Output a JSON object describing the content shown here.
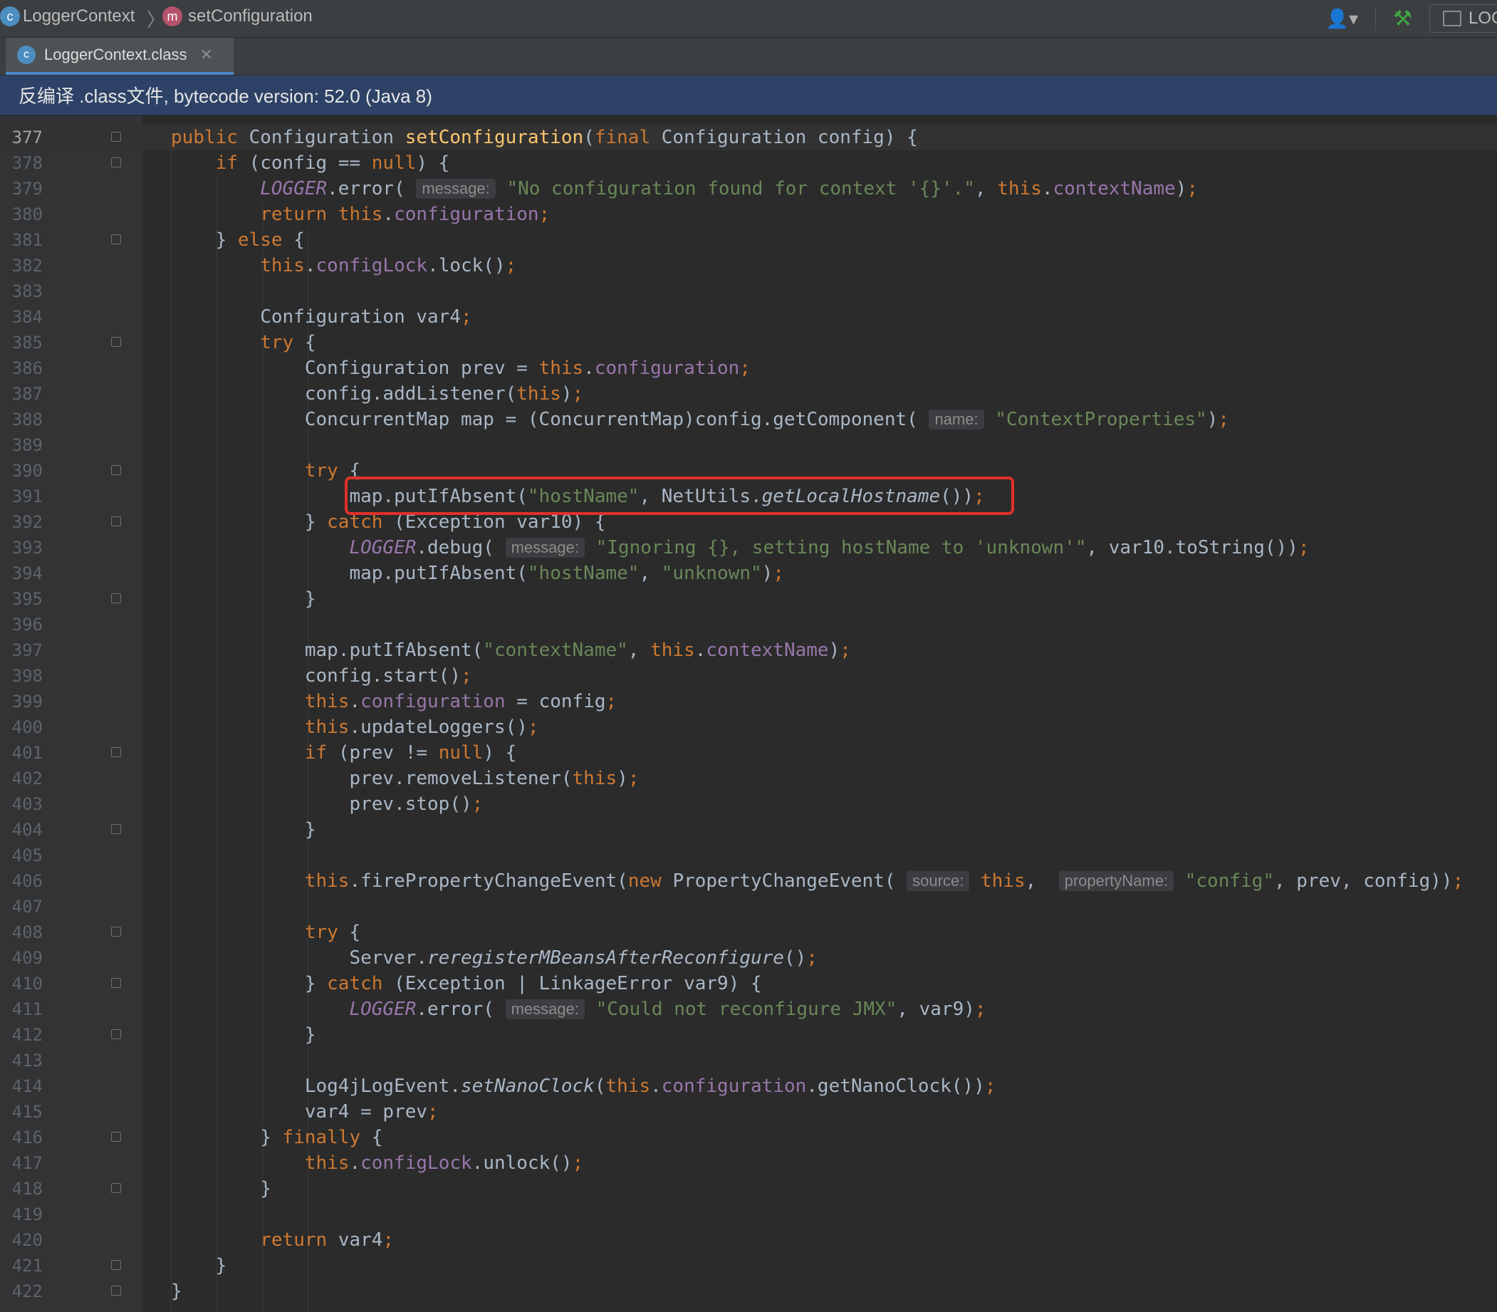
{
  "breadcrumb": {
    "class_icon": "class-icon",
    "class_icon_letter": "c",
    "class_name": "LoggerContext",
    "separator": "〉",
    "method_icon": "method-icon",
    "method_icon_letter": "m",
    "method_name": "setConfiguration"
  },
  "toolbar": {
    "user_icon": "user-dropdown-icon",
    "build_icon": "hammer-icon",
    "run_config_label": "LOG"
  },
  "tab": {
    "icon": "class-file-icon",
    "label": "LoggerContext.class",
    "close": "✕"
  },
  "banner": {
    "text": "反编译 .class文件, bytecode version: 52.0 (Java 8)"
  },
  "editor": {
    "current_line": 377,
    "highlighted_line": 391,
    "highlight_color": "#e0312a",
    "lines": [
      {
        "n": "377",
        "html": "<span class=\"kw\">public </span>Configuration <span class=\"fn\">setConfiguration</span>(<span class=\"kw\">final </span>Configuration config) {"
      },
      {
        "n": "378",
        "html": "    <span class=\"kw\">if </span>(config == <span class=\"kw\">null</span>) {"
      },
      {
        "n": "379",
        "html": "        <span class=\"st\">LOGGER</span>.error( <span class=\"hint\">message:</span> <span class=\"str\">\"No configuration found for context '{}'.\"</span>, <span class=\"kw\">this</span>.<span class=\"fld\">contextName</span>)<span class=\"kw\">;</span>"
      },
      {
        "n": "380",
        "html": "        <span class=\"kw\">return this</span>.<span class=\"fld\">configuration</span><span class=\"kw\">;</span>"
      },
      {
        "n": "381",
        "html": "    } <span class=\"kw\">else </span>{"
      },
      {
        "n": "382",
        "html": "        <span class=\"kw\">this</span>.<span class=\"fld\">configLock</span>.lock()<span class=\"kw\">;</span>"
      },
      {
        "n": "383",
        "html": ""
      },
      {
        "n": "384",
        "html": "        Configuration var4<span class=\"kw\">;</span>"
      },
      {
        "n": "385",
        "html": "        <span class=\"kw\">try </span>{"
      },
      {
        "n": "386",
        "html": "            Configuration prev = <span class=\"kw\">this</span>.<span class=\"fld\">configuration</span><span class=\"kw\">;</span>"
      },
      {
        "n": "387",
        "html": "            config.addListener(<span class=\"kw\">this</span>)<span class=\"kw\">;</span>"
      },
      {
        "n": "388",
        "html": "            ConcurrentMap map = (ConcurrentMap)config.getComponent( <span class=\"hint\">name:</span> <span class=\"str\">\"ContextProperties\"</span>)<span class=\"kw\">;</span>"
      },
      {
        "n": "389",
        "html": ""
      },
      {
        "n": "390",
        "html": "            <span class=\"kw\">try </span>{"
      },
      {
        "n": "391",
        "html": "                map.putIfAbsent(<span class=\"str\">\"hostName\"</span>, NetUtils.<span class=\"it\">getLocalHostname</span>())<span class=\"kw\">;</span>"
      },
      {
        "n": "392",
        "html": "            } <span class=\"kw\">catch </span>(Exception var10) {"
      },
      {
        "n": "393",
        "html": "                <span class=\"st\">LOGGER</span>.debug( <span class=\"hint\">message:</span> <span class=\"str\">\"Ignoring {}, setting hostName to 'unknown'\"</span>, var10.toString())<span class=\"kw\">;</span>"
      },
      {
        "n": "394",
        "html": "                map.putIfAbsent(<span class=\"str\">\"hostName\"</span>, <span class=\"str\">\"unknown\"</span>)<span class=\"kw\">;</span>"
      },
      {
        "n": "395",
        "html": "            }"
      },
      {
        "n": "396",
        "html": ""
      },
      {
        "n": "397",
        "html": "            map.putIfAbsent(<span class=\"str\">\"contextName\"</span>, <span class=\"kw\">this</span>.<span class=\"fld\">contextName</span>)<span class=\"kw\">;</span>"
      },
      {
        "n": "398",
        "html": "            config.start()<span class=\"kw\">;</span>"
      },
      {
        "n": "399",
        "html": "            <span class=\"kw\">this</span>.<span class=\"fld\">configuration</span> = config<span class=\"kw\">;</span>"
      },
      {
        "n": "400",
        "html": "            <span class=\"kw\">this</span>.updateLoggers()<span class=\"kw\">;</span>"
      },
      {
        "n": "401",
        "html": "            <span class=\"kw\">if </span>(prev != <span class=\"kw\">null</span>) {"
      },
      {
        "n": "402",
        "html": "                prev.removeListener(<span class=\"kw\">this</span>)<span class=\"kw\">;</span>"
      },
      {
        "n": "403",
        "html": "                prev.stop()<span class=\"kw\">;</span>"
      },
      {
        "n": "404",
        "html": "            }"
      },
      {
        "n": "405",
        "html": ""
      },
      {
        "n": "406",
        "html": "            <span class=\"kw\">this</span>.firePropertyChangeEvent(<span class=\"kw\">new </span>PropertyChangeEvent( <span class=\"hint\">source:</span> <span class=\"kw\">this</span>,  <span class=\"hint\">propertyName:</span> <span class=\"str\">\"config\"</span>, prev, config))<span class=\"kw\">;</span>"
      },
      {
        "n": "407",
        "html": ""
      },
      {
        "n": "408",
        "html": "            <span class=\"kw\">try </span>{"
      },
      {
        "n": "409",
        "html": "                Server.<span class=\"it\">reregisterMBeansAfterReconfigure</span>()<span class=\"kw\">;</span>"
      },
      {
        "n": "410",
        "html": "            } <span class=\"kw\">catch </span>(Exception | LinkageError var9) {"
      },
      {
        "n": "411",
        "html": "                <span class=\"st\">LOGGER</span>.error( <span class=\"hint\">message:</span> <span class=\"str\">\"Could not reconfigure JMX\"</span>, var9)<span class=\"kw\">;</span>"
      },
      {
        "n": "412",
        "html": "            }"
      },
      {
        "n": "413",
        "html": ""
      },
      {
        "n": "414",
        "html": "            Log4jLogEvent.<span class=\"it\">setNanoClock</span>(<span class=\"kw\">this</span>.<span class=\"fld\">configuration</span>.getNanoClock())<span class=\"kw\">;</span>"
      },
      {
        "n": "415",
        "html": "            var4 = prev<span class=\"kw\">;</span>"
      },
      {
        "n": "416",
        "html": "        } <span class=\"kw\">finally </span>{"
      },
      {
        "n": "417",
        "html": "            <span class=\"kw\">this</span>.<span class=\"fld\">configLock</span>.unlock()<span class=\"kw\">;</span>"
      },
      {
        "n": "418",
        "html": "        }"
      },
      {
        "n": "419",
        "html": ""
      },
      {
        "n": "420",
        "html": "        <span class=\"kw\">return </span>var4<span class=\"kw\">;</span>"
      },
      {
        "n": "421",
        "html": "    }"
      },
      {
        "n": "422",
        "html": "}"
      }
    ],
    "fold_markers": [
      "377",
      "378",
      "381",
      "385",
      "390",
      "392",
      "395",
      "401",
      "404",
      "408",
      "410",
      "412",
      "416",
      "418",
      "421",
      "422"
    ]
  }
}
